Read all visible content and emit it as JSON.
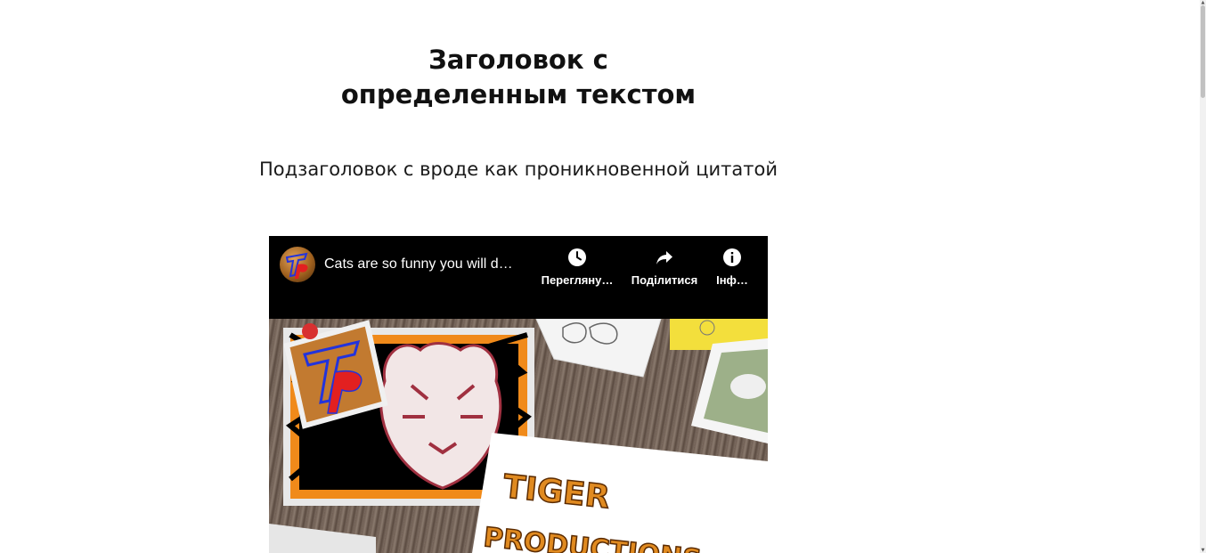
{
  "page": {
    "title_line1": "Заголовок с",
    "title_line2": "определенным текстом",
    "subtitle": "Подзаголовок с вроде как проникновенной цитатой"
  },
  "video": {
    "title": "Cats are so funny you will d…",
    "actions": {
      "watch_later": "Перегляну…",
      "share": "Поділитися",
      "info": "Інф…"
    },
    "icons": {
      "watch_later": "clock-icon",
      "share": "share-icon",
      "info": "info-icon"
    },
    "thumbnail_logo": "Tp",
    "thumbnail_text_1": "TIGER",
    "thumbnail_text_2": "PRODUCTIONS"
  },
  "colors": {
    "background": "#ffffff",
    "text": "#111111",
    "video_bar": "#000000"
  }
}
